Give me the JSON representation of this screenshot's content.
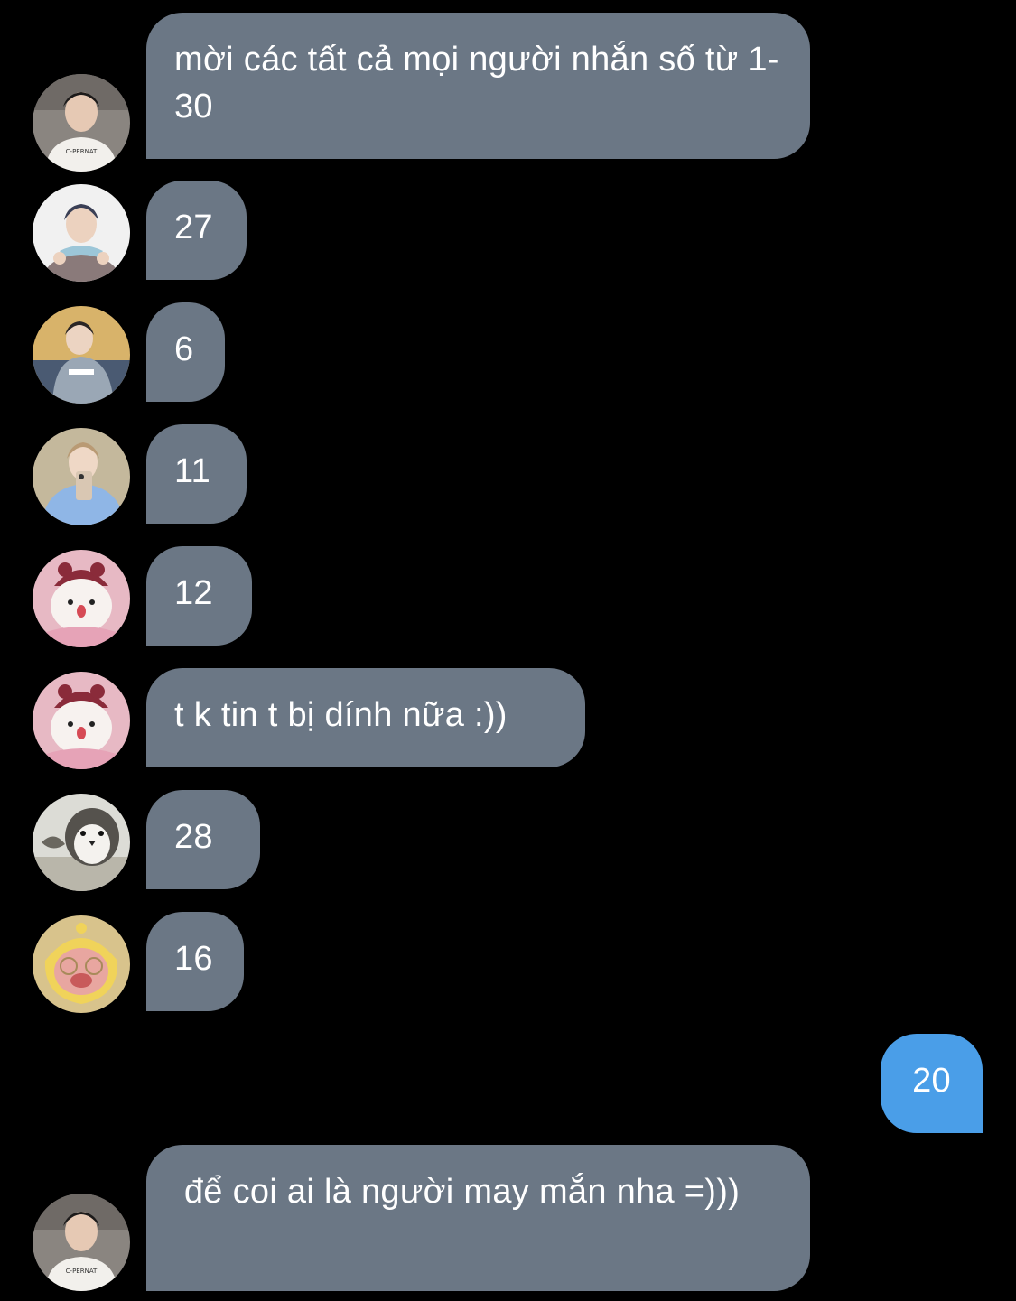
{
  "colors": {
    "background": "#000000",
    "incoming_bubble": "#6b7785",
    "outgoing_bubble": "#4a9ee8",
    "text": "#ffffff"
  },
  "messages": [
    {
      "text": "mời các tất cả mọi người nhắn số từ 1-30",
      "direction": "incoming",
      "avatar": "avatar-boy-white-tshirt"
    },
    {
      "text": "27",
      "direction": "incoming",
      "avatar": "avatar-boy-blue-scarf"
    },
    {
      "text": "6",
      "direction": "incoming",
      "avatar": "avatar-boy-grey-hoodie"
    },
    {
      "text": "11",
      "direction": "incoming",
      "avatar": "avatar-boy-mirror-selfie"
    },
    {
      "text": "12",
      "direction": "incoming",
      "avatar": "avatar-pink-plush"
    },
    {
      "text": "t k tin t bị dính nữa :))",
      "direction": "incoming",
      "avatar": "avatar-pink-plush"
    },
    {
      "text": "28",
      "direction": "incoming",
      "avatar": "avatar-penguin"
    },
    {
      "text": "16",
      "direction": "incoming",
      "avatar": "avatar-yellow-plush"
    },
    {
      "text": "20",
      "direction": "outgoing"
    },
    {
      "text": " để coi ai là người may mắn nha =)))",
      "direction": "incoming",
      "avatar": "avatar-boy-white-tshirt"
    }
  ]
}
